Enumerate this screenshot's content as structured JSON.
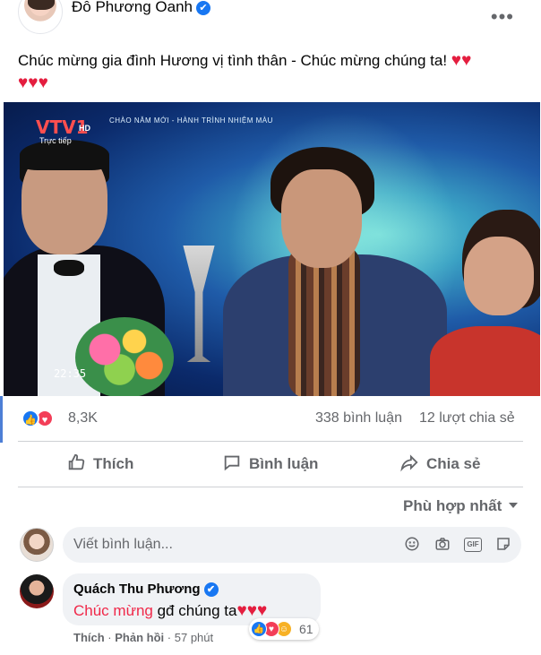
{
  "post": {
    "author": "Đỗ Phương Oanh",
    "verified_symbol": "✔",
    "more_label": "•••",
    "caption": "Chúc mừng gia đình Hương vị tình thân - Chúc mừng chúng ta!",
    "caption_hearts_inline": "♥♥",
    "caption_hearts_line2": "♥♥♥"
  },
  "media": {
    "channel_logo": "VTV1",
    "channel_hd": "HD",
    "live_label": "Trực tiếp",
    "banner": "CHÀO NĂM MỚI - HÀNH TRÌNH NHIỆM MÀU",
    "clock": "22:35"
  },
  "stats": {
    "reaction_count": "8,3K",
    "comment_count": "338 bình luận",
    "share_count": "12 lượt chia sẻ",
    "like_color": "#1877f2",
    "love_color": "#f33e58"
  },
  "actions": {
    "like": "Thích",
    "comment": "Bình luận",
    "share": "Chia sẻ"
  },
  "sort": {
    "label": "Phù hợp nhất"
  },
  "composer": {
    "placeholder": "Viết bình luận...",
    "tools": [
      "emoji-icon",
      "camera-icon",
      "gif-icon",
      "sticker-icon"
    ],
    "gif_label": "GIF"
  },
  "comment": {
    "author": "Quách Thu Phương",
    "text_highlight": "Chúc mừng",
    "text_rest": " gđ chúng ta",
    "text_hearts": "♥♥♥",
    "reaction_count": "61",
    "like_label": "Thích",
    "reply_label": "Phản hồi",
    "time": "57 phút",
    "separator": "·"
  }
}
